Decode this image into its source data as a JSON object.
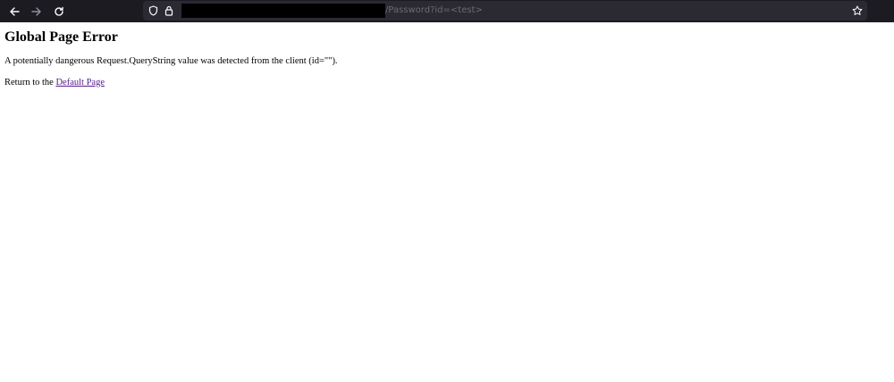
{
  "browser": {
    "url_visible_part": "/Password?id=<test>",
    "colors": {
      "toolbar_bg": "#1c1b22",
      "urlbar_bg": "#2b2a33",
      "icon": "#fbfbfe",
      "url_text": "#6b6a73"
    },
    "icons": {
      "back": "arrow-left-icon",
      "forward": "arrow-right-icon",
      "reload": "reload-icon",
      "shield": "shield-icon",
      "lock": "lock-icon",
      "bookmark": "star-icon"
    }
  },
  "page": {
    "title": "Global Page Error",
    "message": "A potentially dangerous Request.QueryString value was detected from the client (id=\"\").",
    "return_prefix": "Return to the ",
    "return_link": "Default Page",
    "link_color": "#551a8b"
  }
}
